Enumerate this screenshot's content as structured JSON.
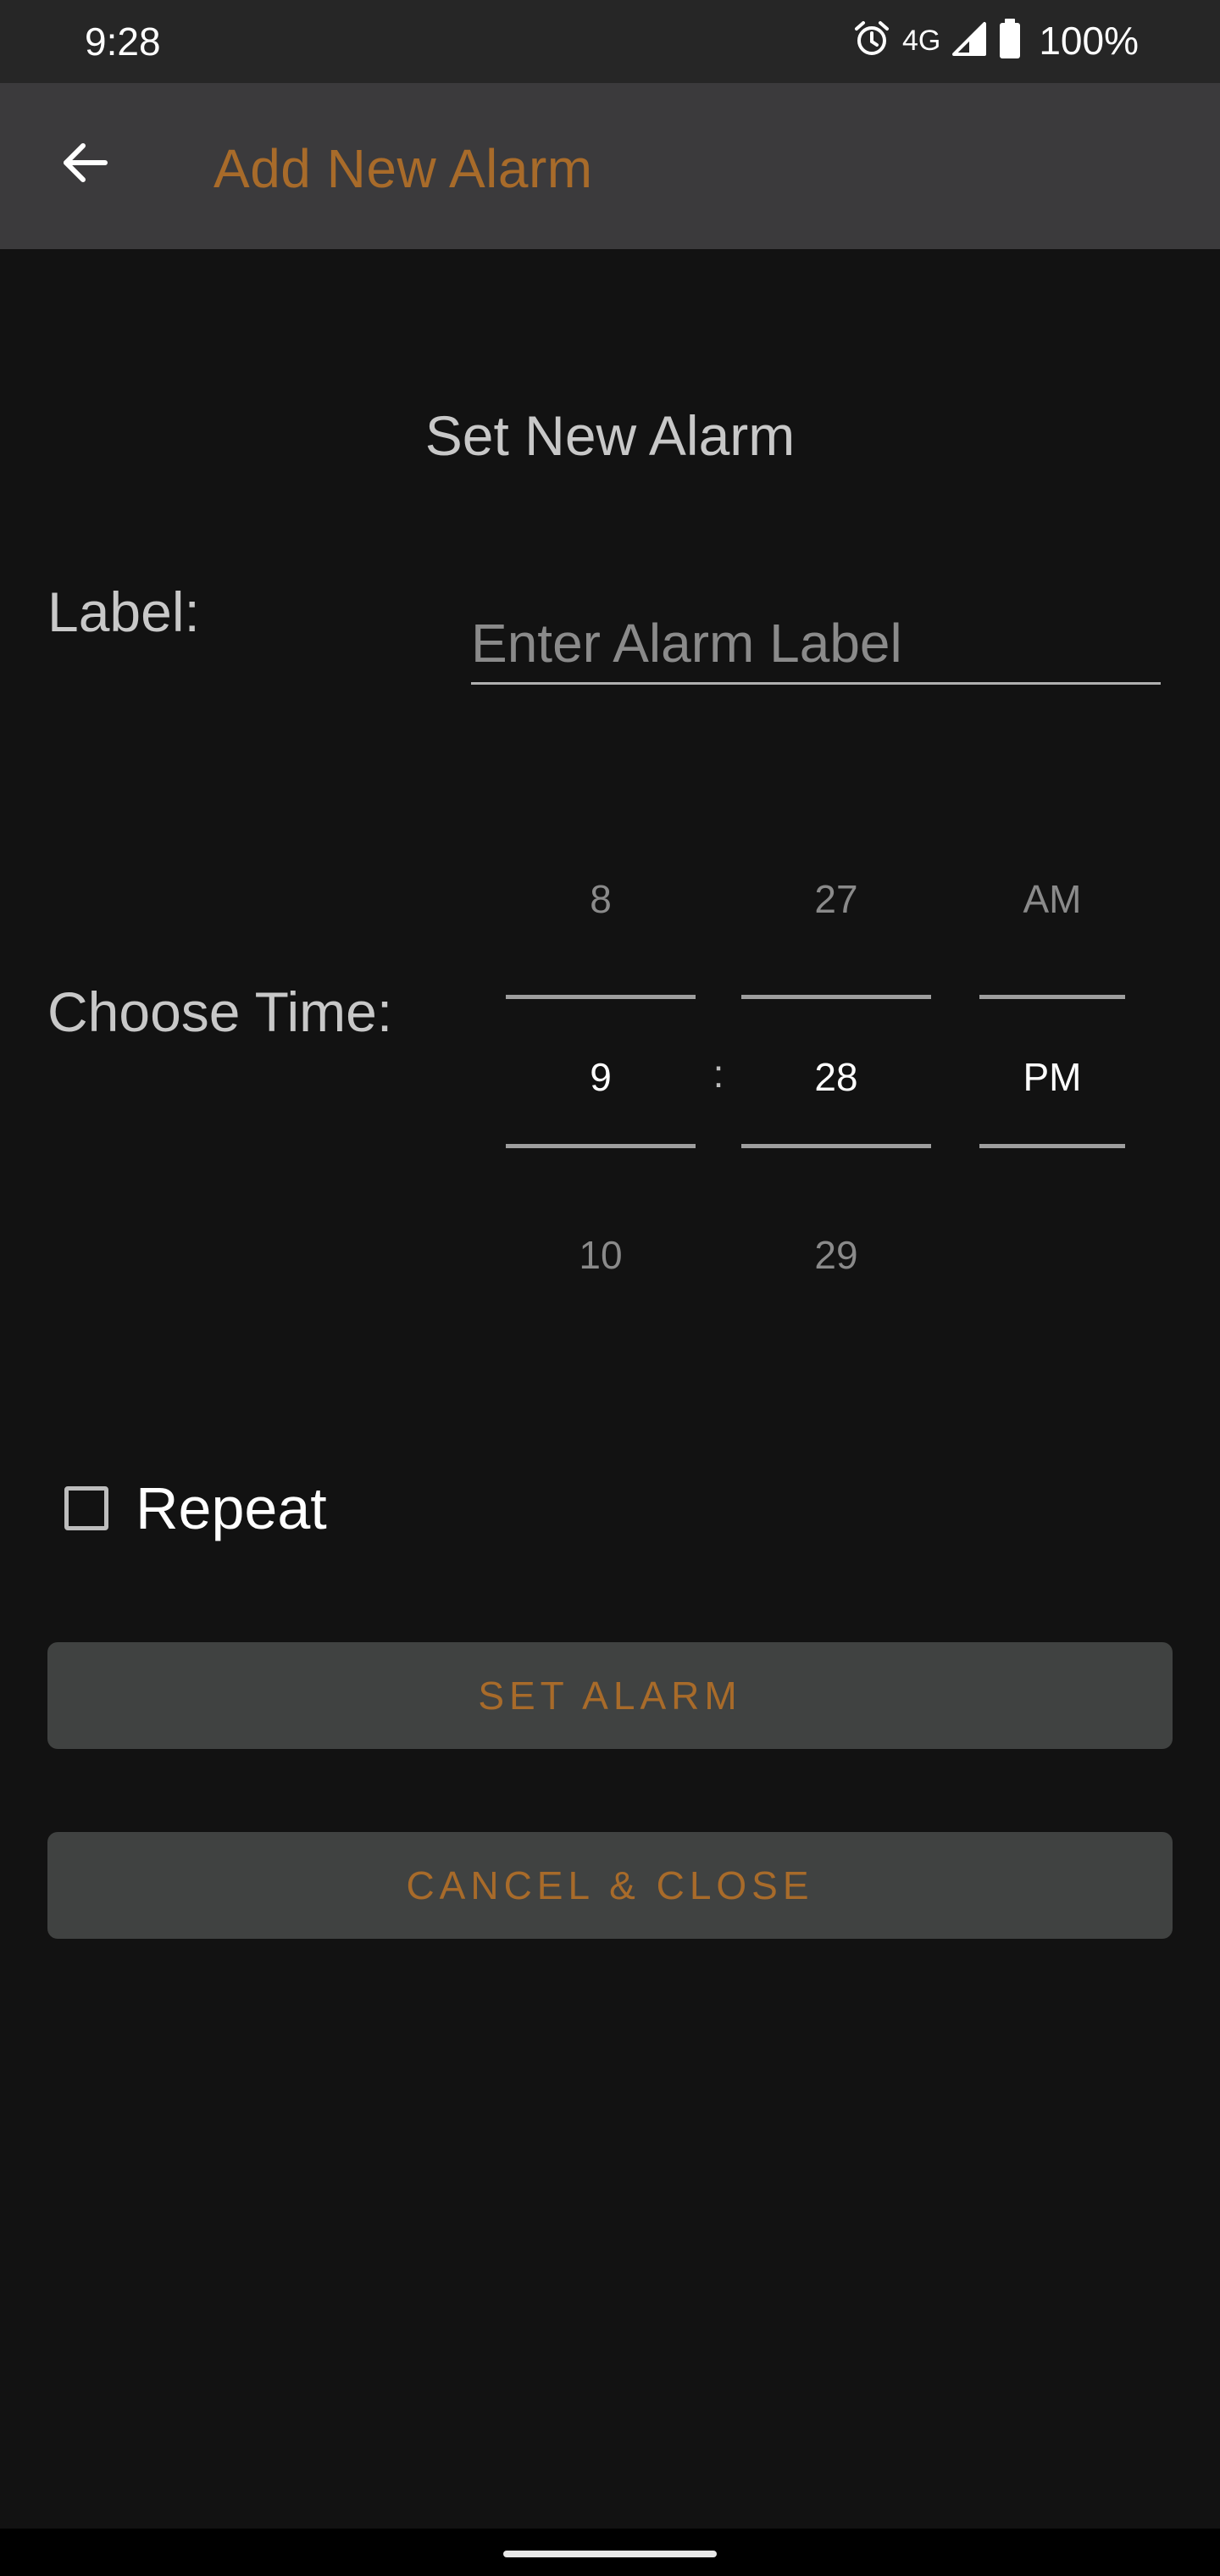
{
  "status_bar": {
    "time": "9:28",
    "network": "4G",
    "battery": "100%",
    "icons": [
      "alarm-icon",
      "signal-icon",
      "battery-icon"
    ]
  },
  "app_bar": {
    "title": "Add New Alarm",
    "back_icon": "arrow-back-icon"
  },
  "form": {
    "heading": "Set New Alarm",
    "label_caption": "Label:",
    "label_placeholder": "Enter Alarm Label",
    "label_value": "",
    "time_caption": "Choose Time:",
    "separator": ":",
    "hour": {
      "prev": "8",
      "current": "9",
      "next": "10"
    },
    "minute": {
      "prev": "27",
      "current": "28",
      "next": "29"
    },
    "ampm": {
      "prev": "AM",
      "current": "PM",
      "next": ""
    },
    "repeat_label": "Repeat",
    "repeat_checked": false
  },
  "buttons": {
    "set_alarm": "SET ALARM",
    "cancel_close": "CANCEL & CLOSE"
  },
  "colors": {
    "accent": "#a86b2a",
    "background": "#121212",
    "app_bar": "#3b3a3c",
    "button": "#404241"
  }
}
